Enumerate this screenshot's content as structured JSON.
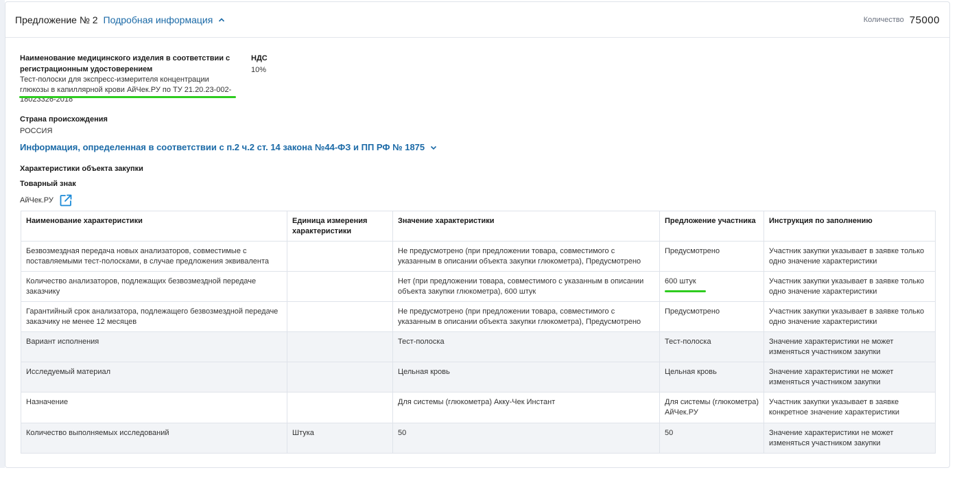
{
  "header": {
    "offer_title": "Предложение № 2",
    "details_link": "Подробная информация",
    "quantity_label": "Количество",
    "quantity_value": "75000"
  },
  "product": {
    "name_label": "Наименование медицинского изделия в соответствии с регистрационным удостоверением",
    "name_value": "Тест-полоски для экспресс-измерителя концентрации глюкозы в капиллярной крови АйЧек.РУ по ТУ 21.20.23-002-18023326-2018",
    "vat_label": "НДС",
    "vat_value": "10%",
    "country_label": "Страна происхождения",
    "country_value": "РОССИЯ",
    "info_link": "Информация, определенная в соответствии с п.2 ч.2 ст. 14 закона №44-ФЗ и ПП РФ № 1875",
    "characteristics_heading": "Характеристики объекта закупки",
    "trademark_label": "Товарный знак",
    "trademark_value": "АйЧек.РУ"
  },
  "table": {
    "headers": [
      "Наименование характеристики",
      "Единица измерения характеристики",
      "Значение характеристики",
      "Предложение участника",
      "Инструкция по заполнению"
    ],
    "rows": [
      [
        "Безвозмездная передача новых анализаторов, совместимые с поставляемыми тест-полосками, в случае предложения эквивалента",
        "",
        "Не предусмотрено (при предложении товара, совместимого с указанным в описании объекта закупки глюкометра), Предусмотрено",
        "Предусмотрено",
        "Участник закупки указывает в заявке только одно значение характеристики"
      ],
      [
        "Количество анализаторов, подлежащих безвозмездной передаче заказчику",
        "",
        "Нет (при предложении товара, совместимого с указанным в описании объекта закупки глюкометра), 600 штук",
        "600 штук",
        "Участник закупки указывает в заявке только одно значение характеристики"
      ],
      [
        "Гарантийный срок анализатора, подлежащего безвозмездной передаче заказчику не менее 12 месяцев",
        "",
        "Не предусмотрено (при предложении товара, совместимого с указанным в описании объекта закупки глюкометра), Предусмотрено",
        "Предусмотрено",
        "Участник закупки указывает в заявке только одно значение характеристики"
      ],
      [
        "Вариант исполнения",
        "",
        "Тест-полоска",
        "Тест-полоска",
        "Значение характеристики не может изменяться участником закупки"
      ],
      [
        "Исследуемый материал",
        "",
        "Цельная кровь",
        "Цельная кровь",
        "Значение характеристики не может изменяться участником закупки"
      ],
      [
        "Назначение",
        "",
        "Для системы (глюкометра) Акку-Чек Инстант",
        "Для системы (глюкометра) АйЧек.РУ",
        "Участник закупки указывает в заявке конкретное значение характеристики"
      ],
      [
        "Количество выполняемых исследований",
        "Штука",
        "50",
        "50",
        "Значение характеристики не может изменяться участником закупки"
      ]
    ]
  },
  "colors": {
    "link": "#1b6aa7",
    "highlight_underline": "#2ecc1f",
    "shaded_row": "#f2f4f7"
  }
}
